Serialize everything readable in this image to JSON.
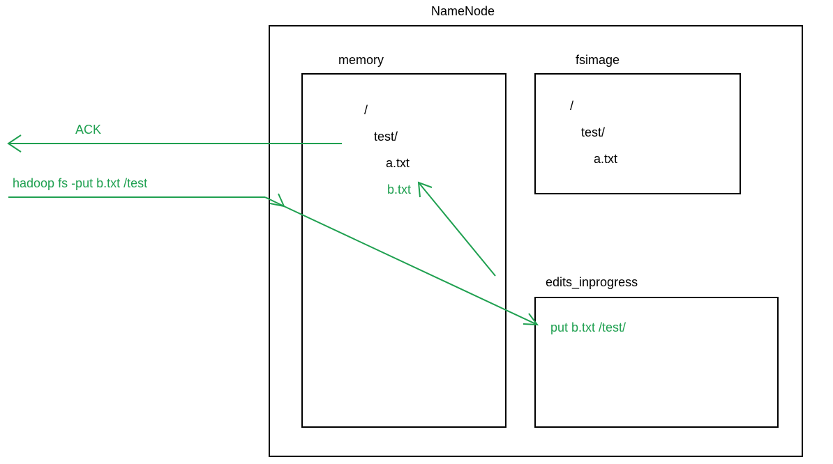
{
  "title": "NameNode",
  "boxes": {
    "memory": {
      "label": "memory",
      "lines": {
        "root": "/",
        "dir": "test/",
        "file_a": "a.txt",
        "file_b": "b.txt"
      }
    },
    "fsimage": {
      "label": "fsimage",
      "lines": {
        "root": "/",
        "dir": "test/",
        "file_a": "a.txt"
      }
    },
    "edits": {
      "label": "edits_inprogress",
      "entry": "put b.txt /test/"
    }
  },
  "arrows": {
    "ack": "ACK",
    "cmd": "hadoop fs -put b.txt /test"
  },
  "colors": {
    "green": "#1fa050",
    "black": "#000000"
  }
}
